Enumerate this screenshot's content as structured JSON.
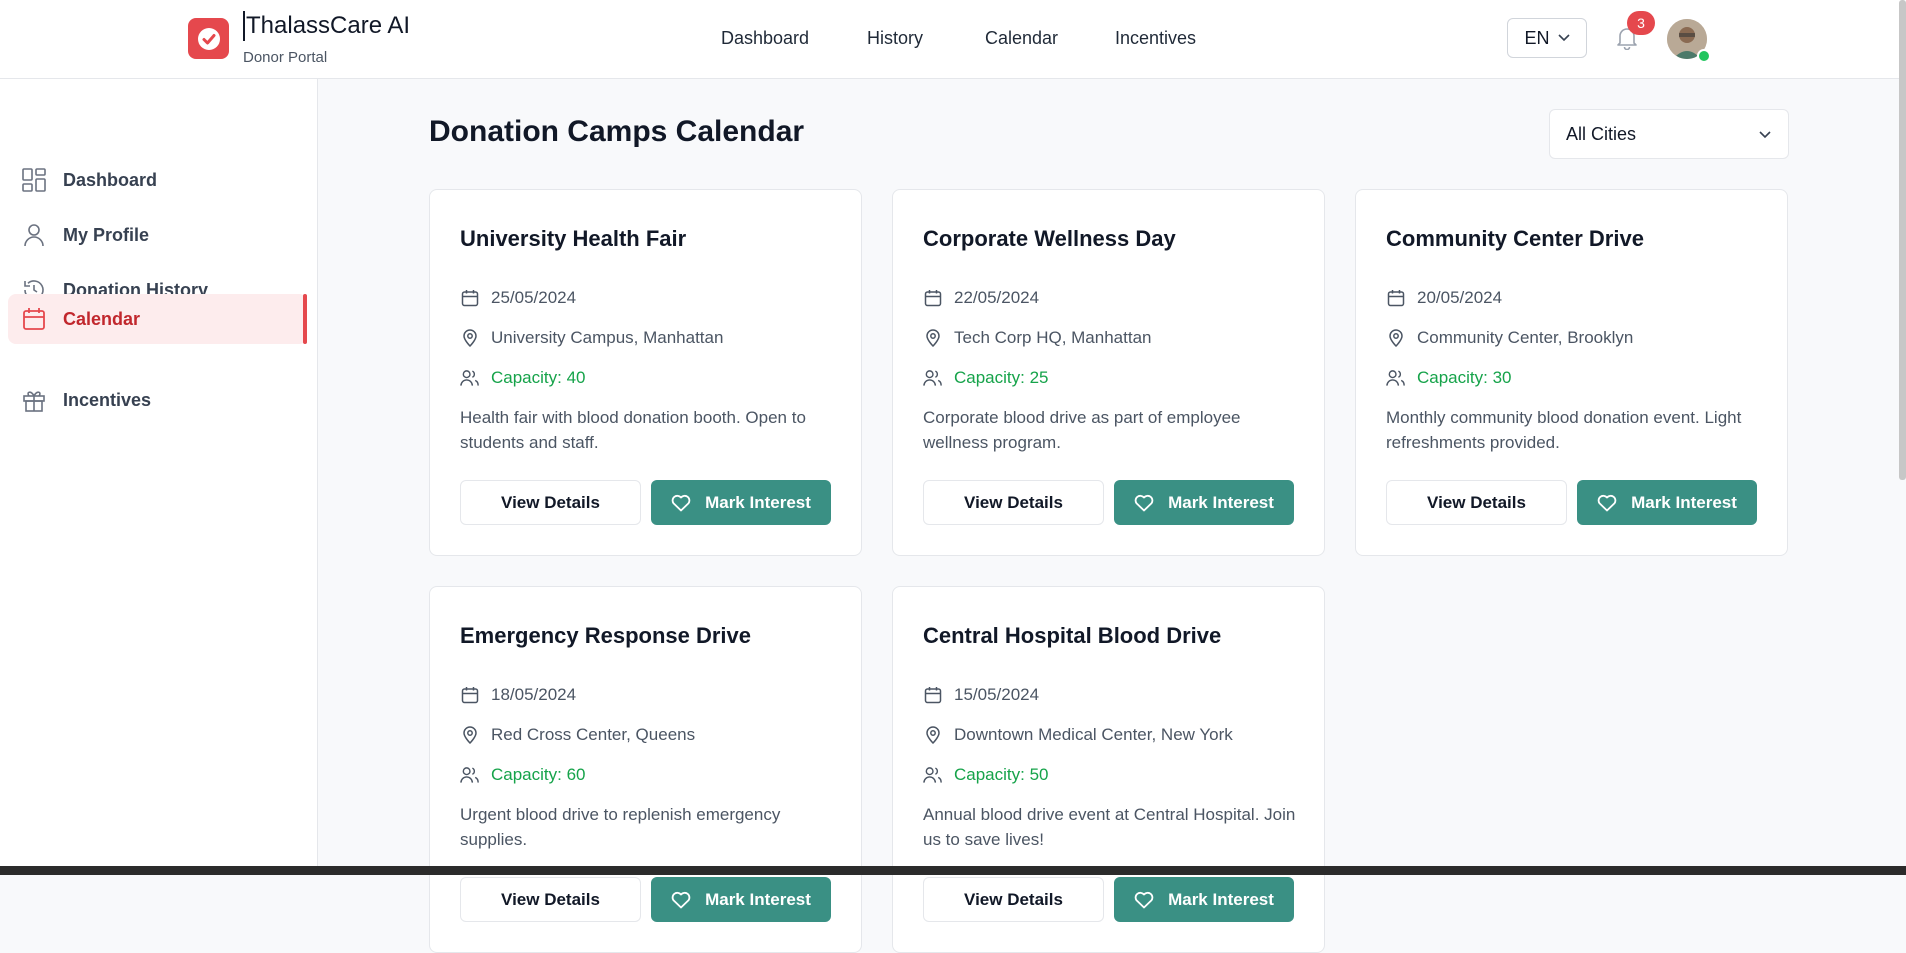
{
  "header": {
    "brand_title": "ThalassCare AI",
    "brand_sub": "Donor Portal",
    "nav": [
      "Dashboard",
      "History",
      "Calendar",
      "Incentives"
    ],
    "lang": "EN",
    "notifications": "3"
  },
  "sidebar": {
    "items": [
      {
        "label": "Dashboard",
        "icon": "grid-icon"
      },
      {
        "label": "My Profile",
        "icon": "user-icon"
      },
      {
        "label": "Donation History",
        "icon": "history-icon"
      },
      {
        "label": "Calendar",
        "icon": "calendar-icon",
        "active": true
      },
      {
        "label": "Incentives",
        "icon": "gift-icon"
      }
    ]
  },
  "main": {
    "title": "Donation Camps Calendar",
    "city_filter": "All Cities",
    "view_label": "View Details",
    "mark_label": "Mark Interest",
    "cards": [
      {
        "title": "University Health Fair",
        "date": "25/05/2024",
        "location": "University Campus, Manhattan",
        "capacity": "Capacity: 40",
        "description": "Health fair with blood donation booth. Open to students and staff."
      },
      {
        "title": "Corporate Wellness Day",
        "date": "22/05/2024",
        "location": "Tech Corp HQ, Manhattan",
        "capacity": "Capacity: 25",
        "description": "Corporate blood drive as part of employee wellness program."
      },
      {
        "title": "Community Center Drive",
        "date": "20/05/2024",
        "location": "Community Center, Brooklyn",
        "capacity": "Capacity: 30",
        "description": "Monthly community blood donation event. Light refreshments provided."
      },
      {
        "title": "Emergency Response Drive",
        "date": "18/05/2024",
        "location": "Red Cross Center, Queens",
        "capacity": "Capacity: 60",
        "description": "Urgent blood drive to replenish emergency supplies."
      },
      {
        "title": "Central Hospital Blood Drive",
        "date": "15/05/2024",
        "location": "Downtown Medical Center, New York",
        "capacity": "Capacity: 50",
        "description": "Annual blood drive event at Central Hospital. Join us to save lives!"
      }
    ]
  },
  "colors": {
    "brand_red": "#e5484d",
    "teal": "#3a9084",
    "capacity_green": "#16a34a"
  }
}
